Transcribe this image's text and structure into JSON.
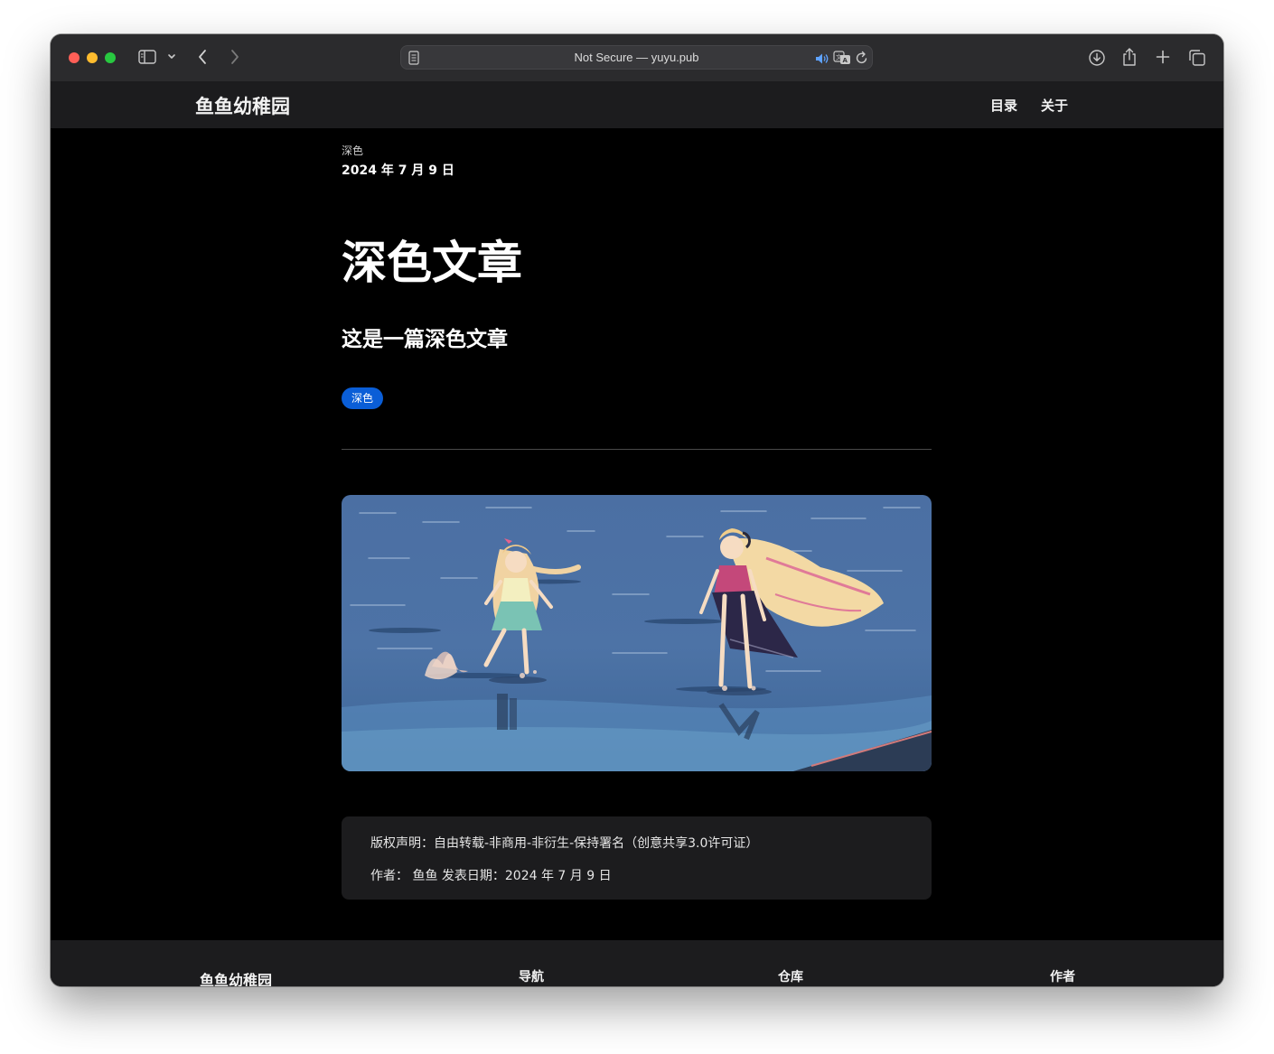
{
  "browser": {
    "address_text": "Not Secure — yuyu.pub",
    "icons": [
      "sidebar-icon",
      "chevron-down-icon",
      "back-arrow-icon",
      "forward-arrow-icon",
      "reader-icon",
      "speaker-icon",
      "translate-icon",
      "reload-icon",
      "download-icon",
      "share-icon",
      "plus-icon",
      "tabs-icon"
    ]
  },
  "site": {
    "title": "鱼鱼幼稚园",
    "nav": {
      "catalog": "目录",
      "about": "关于"
    }
  },
  "post": {
    "category": "深色",
    "date": "2024 年 7 月 9 日",
    "title": "深色文章",
    "subtitle": "这是一篇深色文章",
    "tag": "深色"
  },
  "copyright": {
    "license_line": "版权声明：自由转载-非商用-非衍生-保持署名（创意共享3.0许可证）",
    "author_line": "作者： 鱼鱼 发表日期：2024 年 7 月 9 日"
  },
  "footer": {
    "brand": "鱼鱼幼稚园",
    "nav": "导航",
    "repo": "仓库",
    "author": "作者"
  },
  "colors": {
    "page_bg": "#000000",
    "header_bg": "#1c1c1e",
    "tag_bg": "#0a5ed7",
    "card_bg": "#1c1c1e"
  }
}
